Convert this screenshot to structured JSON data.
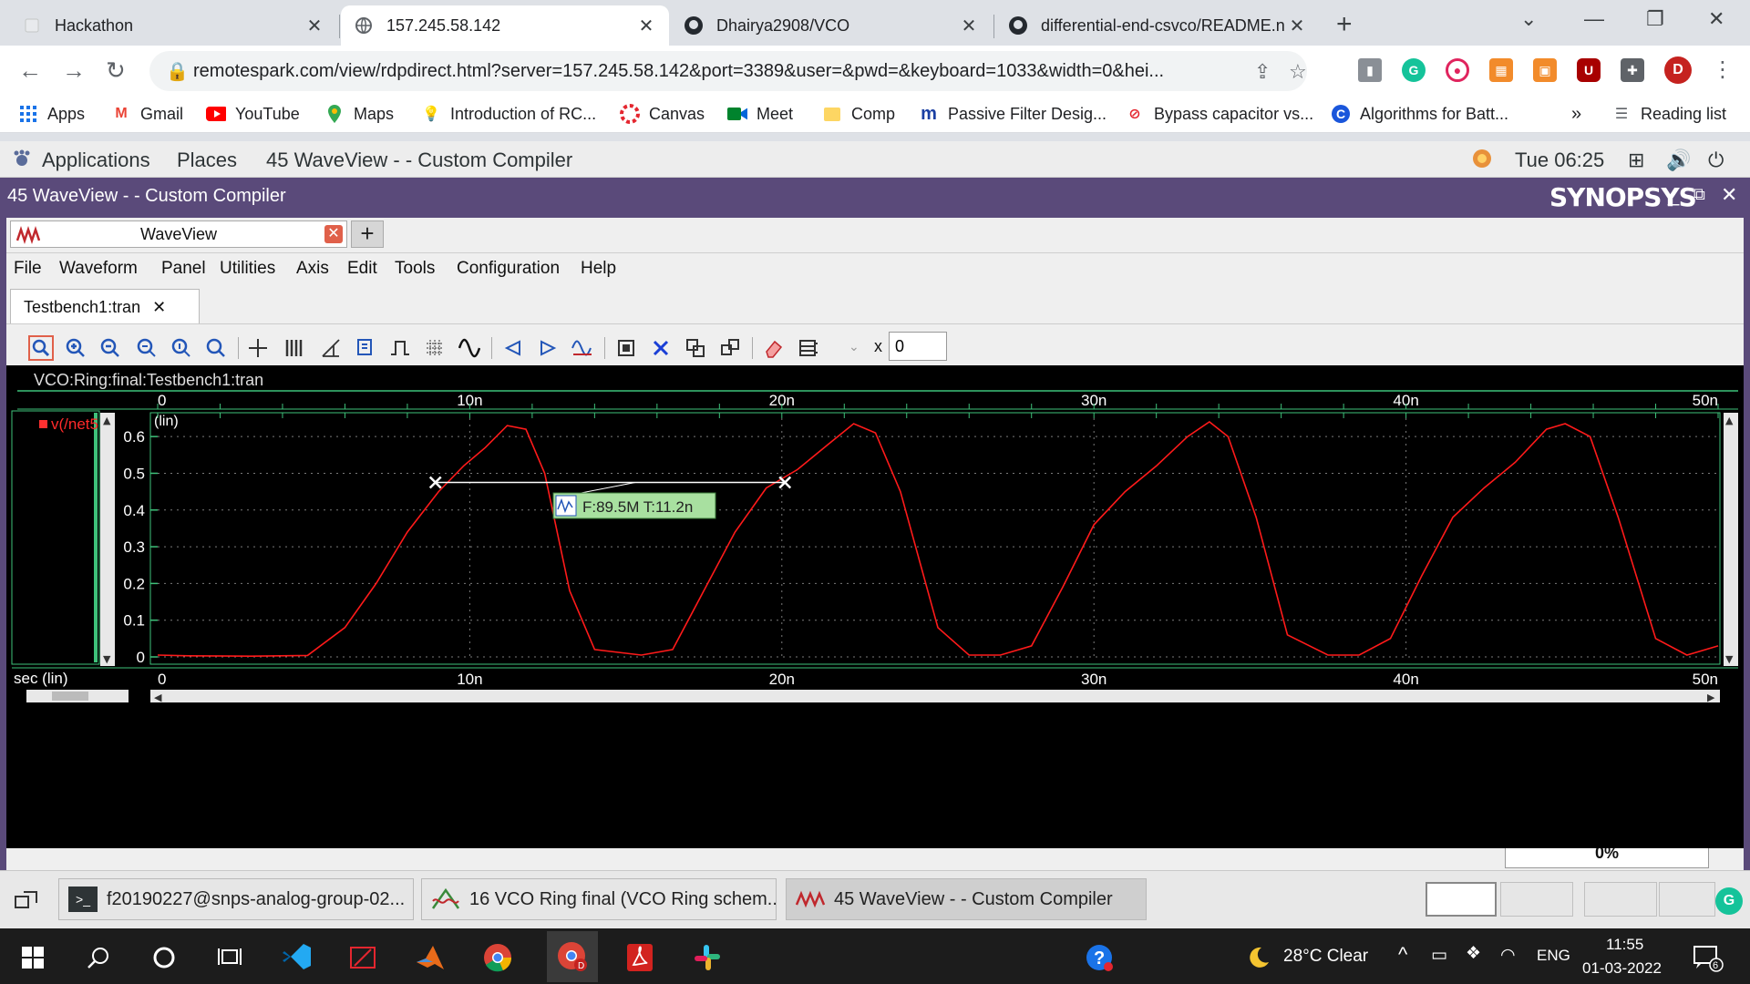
{
  "browser": {
    "tabs": [
      {
        "title": "Hackathon",
        "active": false
      },
      {
        "title": "157.245.58.142",
        "active": true
      },
      {
        "title": "Dhairya2908/VCO",
        "active": false
      },
      {
        "title": "differential-end-csvco/README.n",
        "active": false
      }
    ],
    "url": "remotespark.com/view/rdpdirect.html?server=157.245.58.142&port=3389&user=&pwd=&keyboard=1033&width=0&hei...",
    "profile_initial": "D",
    "bookmarks": [
      "Apps",
      "Gmail",
      "YouTube",
      "Maps",
      "Introduction of RC...",
      "Canvas",
      "Meet",
      "Comp",
      "Passive Filter Desig...",
      "Bypass capacitor vs...",
      "Algorithms for Batt..."
    ],
    "bookmarks_more": "»",
    "reading_list": "Reading list"
  },
  "gnome": {
    "applications": "Applications",
    "places": "Places",
    "active_app": "45 WaveView -  - Custom Compiler",
    "clock": "Tue 06:25"
  },
  "window": {
    "title": "45 WaveView -  - Custom Compiler",
    "brand": "SYNOPSYS",
    "tab_label": "WaveView",
    "menus": [
      "File",
      "Waveform",
      "Panel",
      "Utilities",
      "Axis",
      "Edit",
      "Tools",
      "Configuration",
      "Help"
    ],
    "doc_tab": "Testbench1:tran",
    "x_label": "x",
    "x_value": "0"
  },
  "plot": {
    "panel_title": "VCO:Ring:final:Testbench1:tran",
    "signal_name": "v(/net5",
    "y_scale_label": "(lin)",
    "x_axis_label": "sec (lin)",
    "x_ticks": [
      "0",
      "10n",
      "20n",
      "30n",
      "40n",
      "50n"
    ],
    "y_ticks": [
      "0.6",
      "0.5",
      "0.4",
      "0.3",
      "0.2",
      "0.1",
      "0"
    ],
    "measurement": "F:89.5M T:11.2n",
    "trace_color": "#ff1a1a",
    "progress": "0%"
  },
  "chart_data": {
    "type": "line",
    "title": "VCO:Ring:final:Testbench1:tran",
    "xlabel": "sec (lin)",
    "ylabel": "(lin)",
    "xlim": [
      0,
      5e-08
    ],
    "ylim": [
      0,
      0.65
    ],
    "grid": true,
    "series": [
      {
        "name": "v(/net5",
        "x": [
          0,
          1e-09,
          3e-09,
          4.8e-09,
          6e-09,
          7e-09,
          8e-09,
          9e-09,
          9.8e-09,
          1.05e-08,
          1.12e-08,
          1.18e-08,
          1.24e-08,
          1.32e-08,
          1.4e-08,
          1.55e-08,
          1.65e-08,
          1.75e-08,
          1.85e-08,
          1.95e-08,
          2.05e-08,
          2.15e-08,
          2.23e-08,
          2.3e-08,
          2.38e-08,
          2.5e-08,
          2.6e-08,
          2.7e-08,
          2.8e-08,
          2.9e-08,
          3e-08,
          3.1e-08,
          3.2e-08,
          3.3e-08,
          3.37e-08,
          3.43e-08,
          3.52e-08,
          3.62e-08,
          3.75e-08,
          3.85e-08,
          3.95e-08,
          4.05e-08,
          4.15e-08,
          4.25e-08,
          4.35e-08,
          4.45e-08,
          4.51e-08,
          4.59e-08,
          4.68e-08,
          4.8e-08,
          4.9e-08,
          5e-08
        ],
        "y": [
          0.005,
          0.003,
          0.002,
          0.004,
          0.08,
          0.2,
          0.34,
          0.45,
          0.52,
          0.57,
          0.63,
          0.62,
          0.5,
          0.18,
          0.02,
          0.005,
          0.02,
          0.18,
          0.34,
          0.46,
          0.51,
          0.58,
          0.635,
          0.61,
          0.45,
          0.08,
          0.005,
          0.005,
          0.03,
          0.19,
          0.36,
          0.45,
          0.52,
          0.6,
          0.64,
          0.6,
          0.38,
          0.06,
          0.005,
          0.005,
          0.05,
          0.22,
          0.38,
          0.46,
          0.53,
          0.62,
          0.635,
          0.6,
          0.38,
          0.05,
          0.005,
          0.03
        ]
      }
    ],
    "markers": [
      {
        "x": 8.9e-09,
        "y": 0.475
      },
      {
        "x": 2.01e-08,
        "y": 0.475
      }
    ]
  }
}
